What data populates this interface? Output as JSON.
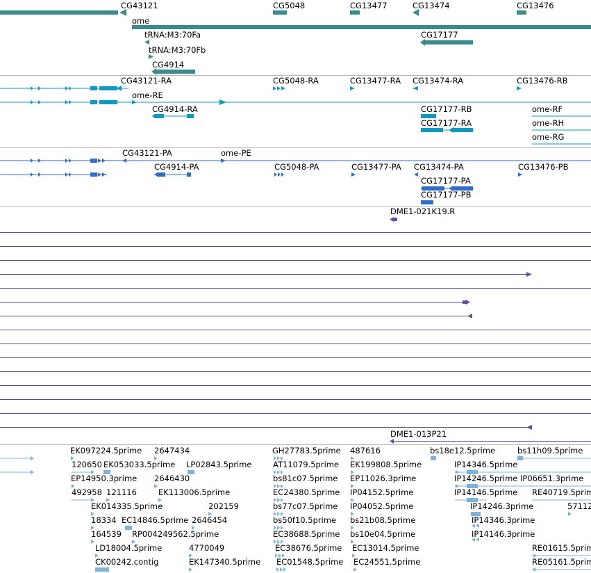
{
  "colors": {
    "gene": "#3a8c8c",
    "transcript": "#1199c0",
    "cds": "#2f6dc8",
    "bac": "#6a4c9c",
    "bacline": "#5e4a86",
    "est": "#7fb2d8",
    "separator": "#b9b9b9"
  },
  "tracks": {
    "genes": {
      "labels": [
        "CG43121",
        "CG5048",
        "CG13477",
        "CG13474",
        "CG13476",
        "ome",
        "tRNA:M3:70Fa",
        "CG17177",
        "tRNA:M3:70Fb",
        "CG4914"
      ]
    },
    "transcripts": {
      "labels": [
        "CG43121-RA",
        "CG5048-RA",
        "CG13477-RA",
        "CG13474-RA",
        "CG13476-RB",
        "ome-RE",
        "CG4914-RA",
        "CG17177-RB",
        "ome-RF",
        "CG17177-RA",
        "ome-RH",
        "ome-RG"
      ]
    },
    "proteins": {
      "labels": [
        "CG43121-PA",
        "ome-PE",
        "CG4914-PA",
        "CG5048-PA",
        "CG13477-PA",
        "CG13474-PA",
        "CG13476-PB",
        "CG17177-PA",
        "CG17177-PB"
      ]
    },
    "bacs": {
      "labels": [
        "DME1-021K19.R",
        "DME1-013P21"
      ]
    },
    "ests": {
      "labels": [
        "EK097224.5prime",
        "2647434",
        "GH27783.5prime",
        "487616",
        "bs18e12.5prime",
        "bs11h09.5prime",
        "120650",
        "EK053033.5prime",
        "LP02843.5prime",
        "AT11079.5prime",
        "EK199808.5prime",
        "IP14346.5prime",
        "EP14950.3prime",
        "2646430",
        "bs81c07.5prime",
        "EP11026.3prime",
        "IP14246.5prime",
        "IP06651.3prime",
        "492958",
        "121116",
        "EK113006.5prime",
        "EC24380.5prime",
        "IP04152.5prime",
        "IP14146.5prime",
        "RE40719.5prime",
        "EK014335.5prime",
        "202159",
        "bs77c07.5prime",
        "IP04052.5prime",
        "IP14246.3prime",
        "57112",
        "18334",
        "EC14846.5prime",
        "2646454",
        "bs50f10.5prime",
        "bs21b08.5prime",
        "IP14346.3prime",
        "164539",
        "RP004249562.5prime",
        "EC38688.5prime",
        "bs10e04.5prime",
        "IP14146.3prime",
        "LD18004.5prime",
        "4770049",
        "EC38676.5prime",
        "EC13014.5prime",
        "RE01615.5prime",
        "CK00242.contig",
        "EK147340.5prime",
        "EC01548.5prime",
        "EC24551.5prime",
        "RE05161.5prime"
      ]
    }
  }
}
